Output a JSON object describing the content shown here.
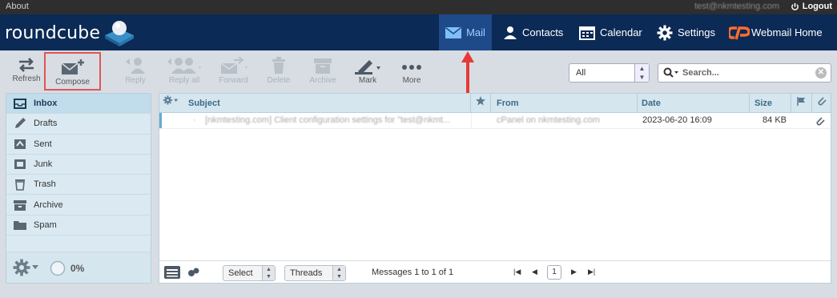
{
  "topline": {
    "about": "About",
    "user_email": "test@nkmtesting.com",
    "logout": "Logout"
  },
  "header": {
    "logo_text": "roundcube",
    "nav": [
      {
        "label": "Mail"
      },
      {
        "label": "Contacts"
      },
      {
        "label": "Calendar"
      },
      {
        "label": "Settings"
      },
      {
        "label": "Webmail Home"
      }
    ]
  },
  "toolbar": {
    "refresh": "Refresh",
    "compose": "Compose",
    "reply": "Reply",
    "reply_all": "Reply all",
    "forward": "Forward",
    "delete": "Delete",
    "archive": "Archive",
    "mark": "Mark",
    "more": "More",
    "filter_value": "All",
    "search_placeholder": "Search..."
  },
  "folders": [
    {
      "name": "Inbox",
      "icon": "inbox-icon"
    },
    {
      "name": "Drafts",
      "icon": "pencil-icon"
    },
    {
      "name": "Sent",
      "icon": "sent-icon"
    },
    {
      "name": "Junk",
      "icon": "junk-icon"
    },
    {
      "name": "Trash",
      "icon": "trash-icon"
    },
    {
      "name": "Archive",
      "icon": "archive-icon"
    },
    {
      "name": "Spam",
      "icon": "folder-icon"
    }
  ],
  "quota": "0%",
  "message_list": {
    "columns": {
      "subject": "Subject",
      "from": "From",
      "date": "Date",
      "size": "Size"
    },
    "rows": [
      {
        "subject": "[nkmtesting.com] Client configuration settings for \"test@nkmt...",
        "from": "cPanel on nkmtesting.com",
        "date": "2023-06-20 16:09",
        "size": "84 KB"
      }
    ]
  },
  "footer": {
    "select": "Select",
    "threads": "Threads",
    "count_text": "Messages 1 to 1 of 1",
    "page": "1"
  },
  "colors": {
    "header_bg": "#0b2a55",
    "mail_active": "#1e4a8a",
    "accent_red": "#e05555"
  }
}
